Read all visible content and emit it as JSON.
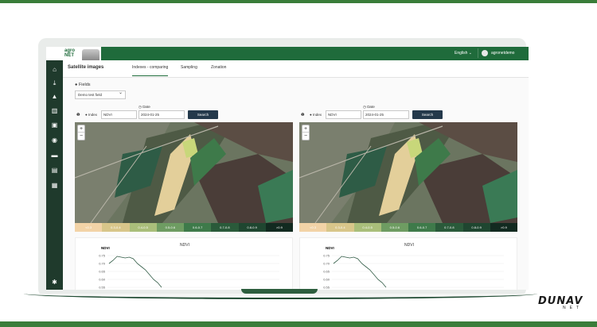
{
  "app": {
    "title": "Satellite images",
    "language": "English",
    "user": "agronetdemo"
  },
  "sidebar": {
    "icons": [
      "home-icon",
      "download-icon",
      "education-icon",
      "building-icon",
      "barn-icon",
      "tractor-icon",
      "truck-icon",
      "calendar-icon",
      "calendar-check-icon",
      "settings-icon"
    ]
  },
  "tabs": [
    {
      "label": "Indexes - comparing",
      "active": true
    },
    {
      "label": "Sampling",
      "active": false
    },
    {
      "label": "Zonation",
      "active": false
    }
  ],
  "fields": {
    "label": "Fields",
    "selected": "Demo test field"
  },
  "panels": [
    {
      "index_label": "Index",
      "index_value": "NDVI",
      "date_label": "Date",
      "date_value": "2024-01-25",
      "search": "Search",
      "legend": [
        "<0.3",
        "0.3-0.4",
        "0.4-0.5",
        "0.5-0.6",
        "0.6-0.7",
        "0.7-0.8",
        "0.8-0.9",
        ">0.9"
      ],
      "chart_title": "NDVI",
      "chart_ylabel": "NDVI",
      "chart_ticks": [
        "0.75",
        "0.70",
        "0.65",
        "0.60",
        "0.55"
      ]
    },
    {
      "index_label": "Index",
      "index_value": "NDVI",
      "date_label": "Date",
      "date_value": "2024-01-25",
      "search": "Search",
      "legend": [
        "<0.3",
        "0.3-0.4",
        "0.4-0.5",
        "0.5-0.6",
        "0.6-0.7",
        "0.7-0.8",
        "0.8-0.9",
        ">0.9"
      ],
      "chart_title": "NDVI",
      "chart_ylabel": "NDVI",
      "chart_ticks": [
        "0.75",
        "0.70",
        "0.65",
        "0.60",
        "0.55"
      ]
    }
  ],
  "legend_colors": [
    "#f2d3a7",
    "#d8c68a",
    "#a9be7a",
    "#6e9c62",
    "#3e7a4a",
    "#2a5a3a",
    "#1f4630",
    "#122a20"
  ],
  "chart_data": [
    {
      "type": "line",
      "title": "NDVI",
      "ylabel": "NDVI",
      "ylim": [
        0.53,
        0.77
      ],
      "series": [
        {
          "values": [
            0.7,
            0.72,
            0.745,
            0.74,
            0.735,
            0.74,
            0.73,
            0.7,
            0.68,
            0.66,
            0.63,
            0.6,
            0.58,
            0.55
          ]
        }
      ]
    },
    {
      "type": "line",
      "title": "NDVI",
      "ylabel": "NDVI",
      "ylim": [
        0.53,
        0.77
      ],
      "series": [
        {
          "values": [
            0.7,
            0.72,
            0.745,
            0.74,
            0.735,
            0.74,
            0.73,
            0.7,
            0.68,
            0.66,
            0.63,
            0.6,
            0.58,
            0.55
          ]
        }
      ]
    }
  ],
  "brand": {
    "name": "DUNAV",
    "sub": "NET"
  }
}
